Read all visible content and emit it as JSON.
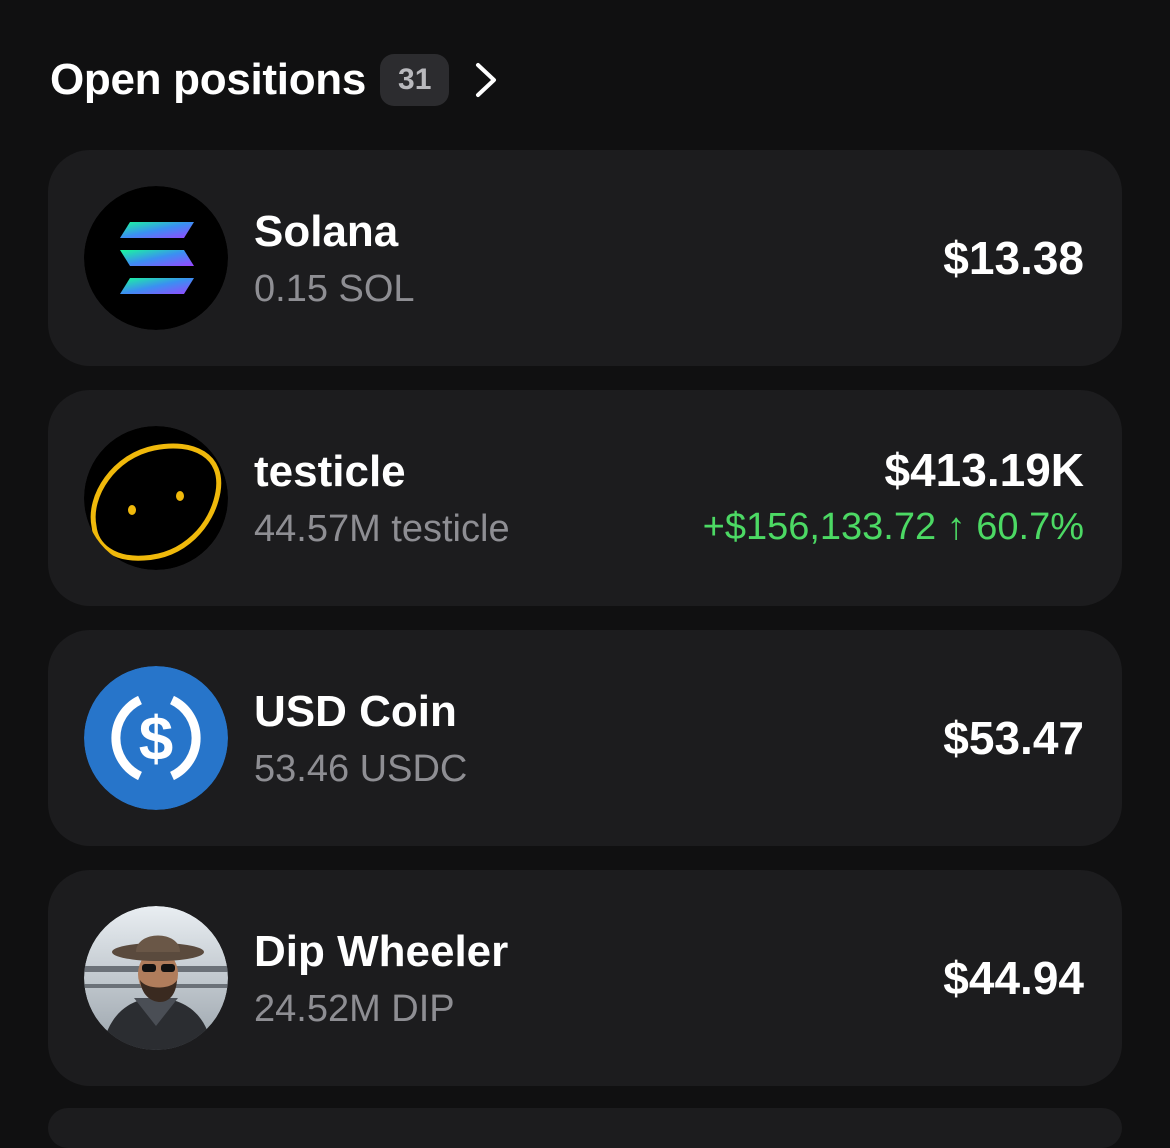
{
  "header": {
    "title": "Open positions",
    "count": "31",
    "chevron_icon": "chevron-right-icon"
  },
  "positions": [
    {
      "name": "Solana",
      "quantity": "0.15 SOL",
      "value": "$13.38",
      "pnl": "",
      "icon": "solana-logo-icon"
    },
    {
      "name": "testicle",
      "quantity": "44.57M testicle",
      "value": "$413.19K",
      "pnl": "+$156,133.72 ↑ 60.7%",
      "icon": "testicle-token-icon"
    },
    {
      "name": "USD Coin",
      "quantity": "53.46 USDC",
      "value": "$53.47",
      "pnl": "",
      "icon": "usdc-logo-icon"
    },
    {
      "name": "Dip Wheeler",
      "quantity": "24.52M DIP",
      "value": "$44.94",
      "pnl": "",
      "icon": "dip-wheeler-avatar-icon"
    }
  ],
  "colors": {
    "background": "#101011",
    "card": "#1c1c1e",
    "secondary_text": "#8e8e93",
    "positive": "#4cd964",
    "usdc_blue": "#2775ca",
    "testicle_yellow": "#f0b90b"
  }
}
